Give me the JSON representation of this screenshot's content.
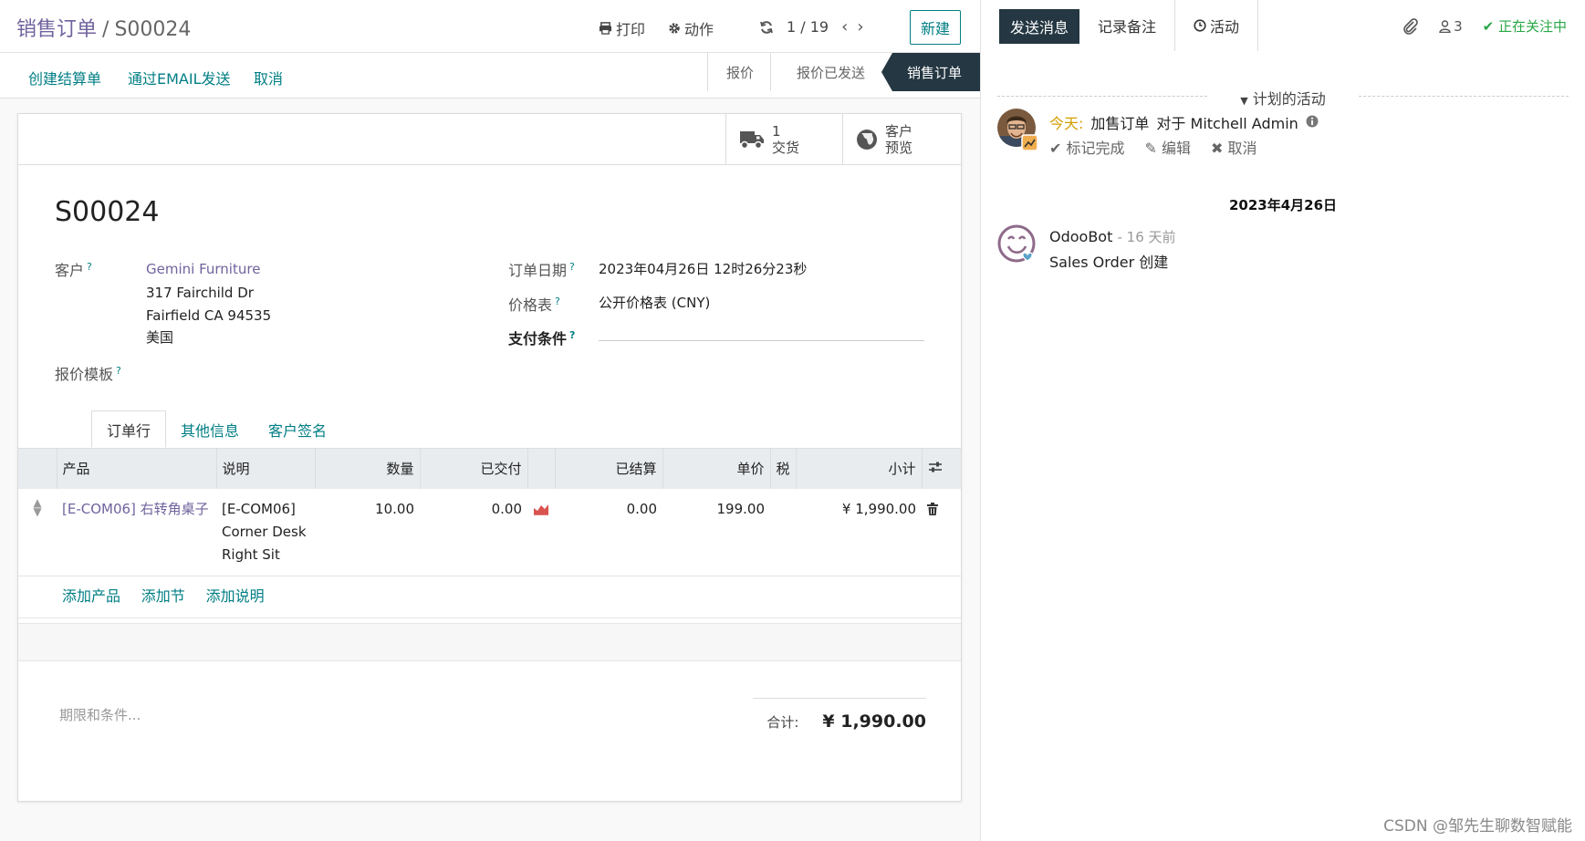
{
  "header": {
    "breadcrumb_parent": "销售订单",
    "breadcrumb_separator": "/",
    "breadcrumb_current": "S00024",
    "print_label": "打印",
    "action_label": "动作",
    "pager_value": "1 / 19",
    "new_label": "新建"
  },
  "control": {
    "buttons": [
      "创建结算单",
      "通过EMAIL发送",
      "取消"
    ],
    "status_steps": [
      "报价",
      "报价已发送",
      "销售订单"
    ]
  },
  "smart_buttons": {
    "delivery_count": "1",
    "delivery_label": "交货",
    "preview_line1": "客户",
    "preview_line2": "预览"
  },
  "form": {
    "name": "S00024",
    "customer_label": "客户",
    "customer_name": "Gemini Furniture",
    "customer_address": [
      "317 Fairchild Dr",
      "Fairfield CA 94535",
      "美国"
    ],
    "template_label": "报价模板",
    "order_date_label": "订单日期",
    "order_date_value": "2023年04月26日 12时26分23秒",
    "pricelist_label": "价格表",
    "pricelist_value": "公开价格表 (CNY)",
    "payment_terms_label": "支付条件",
    "help_mark": "?"
  },
  "tabs": [
    "订单行",
    "其他信息",
    "客户签名"
  ],
  "lines": {
    "columns": [
      "产品",
      "说明",
      "数量",
      "已交付",
      "已结算",
      "单价",
      "税",
      "小计"
    ],
    "rows": [
      {
        "product": "[E-COM06] 右转角桌子",
        "description": [
          "[E-COM06]",
          "Corner Desk",
          "Right Sit"
        ],
        "quantity": "10.00",
        "delivered": "0.00",
        "invoiced": "0.00",
        "unit_price": "199.00",
        "taxes": "",
        "subtotal": "¥ 1,990.00"
      }
    ],
    "add_links": [
      "添加产品",
      "添加节",
      "添加说明"
    ]
  },
  "footer": {
    "terms_placeholder": "期限和条件...",
    "total_label": "合计:",
    "total_value": "¥ 1,990.00"
  },
  "chatter": {
    "tabs": [
      "发送消息",
      "记录备注",
      "活动"
    ],
    "followers_count": "3",
    "following_label": "正在关注中",
    "planned_label": "计划的活动",
    "activity": {
      "today": "今天:",
      "summary": "加售订单",
      "for_text": "对于 Mitchell Admin",
      "actions": [
        "标记完成",
        "编辑",
        "取消"
      ]
    },
    "date_separator": "2023年4月26日",
    "message": {
      "author": "OdooBot",
      "time": "- 16 天前",
      "body": "Sales Order 创建"
    }
  },
  "watermark": "CSDN @邹先生聊数智赋能",
  "colors": {
    "accent": "#017e84",
    "brand": "#71639e",
    "dark": "#243742",
    "following": "#28a745"
  }
}
